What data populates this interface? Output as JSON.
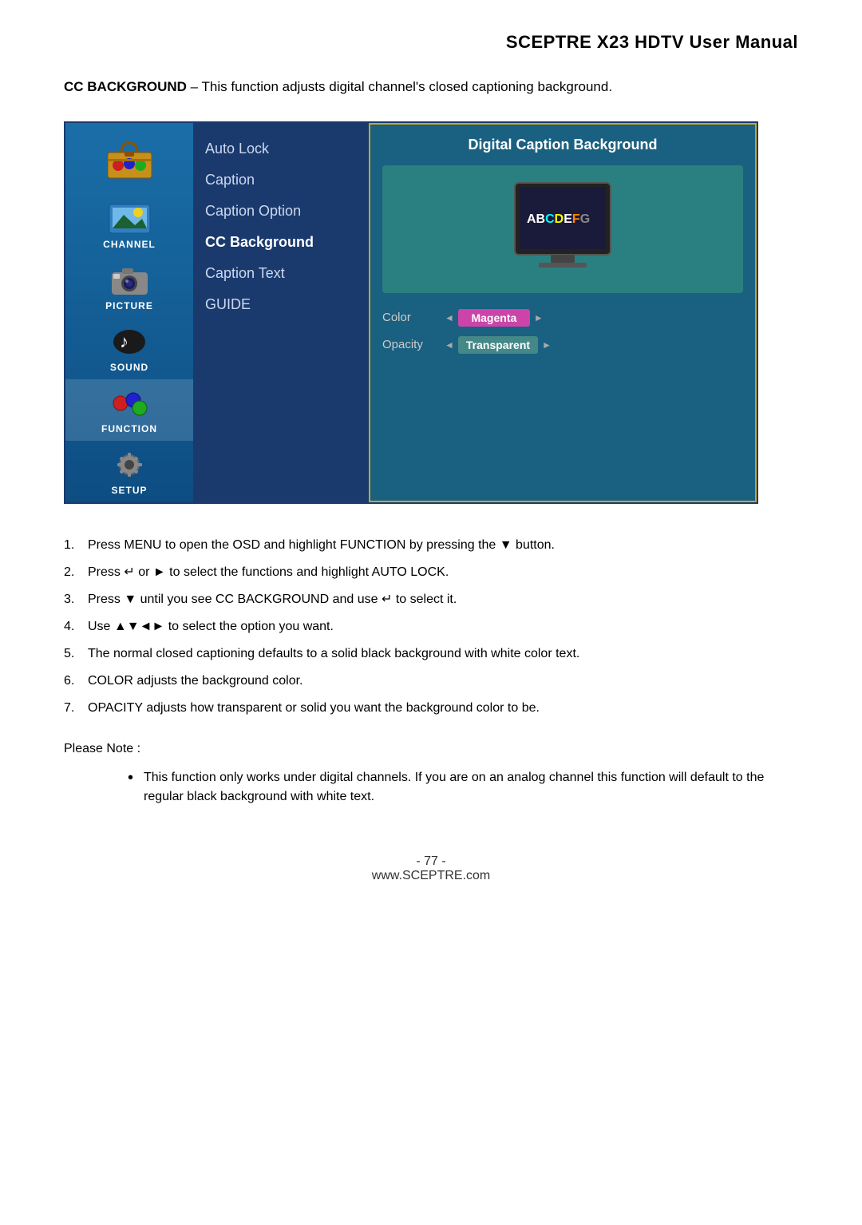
{
  "header": {
    "title": "SCEPTRE X23 HDTV User Manual"
  },
  "intro": {
    "bold": "CC BACKGROUND",
    "text": " – This function adjusts digital channel's closed captioning background."
  },
  "osd": {
    "sidebar": {
      "items": [
        {
          "label": "",
          "id": "toolbox",
          "active": false
        },
        {
          "label": "CHANNEL",
          "id": "channel",
          "active": false
        },
        {
          "label": "PICTURE",
          "id": "picture",
          "active": false
        },
        {
          "label": "SOUND",
          "id": "sound",
          "active": false
        },
        {
          "label": "FUNCTION",
          "id": "function",
          "active": true
        },
        {
          "label": "SETUP",
          "id": "setup",
          "active": false
        }
      ]
    },
    "menu": {
      "items": [
        {
          "label": "Auto Lock",
          "active": false
        },
        {
          "label": "Caption",
          "active": false
        },
        {
          "label": "Caption Option",
          "active": false
        },
        {
          "label": "CC Background",
          "active": true
        },
        {
          "label": "Caption Text",
          "active": false
        },
        {
          "label": "GUIDE",
          "active": false
        }
      ]
    },
    "panel": {
      "title": "Digital Caption Background",
      "caption_demo": "ABCDEFG",
      "options": [
        {
          "label": "Color",
          "value": "Magenta",
          "style": "magenta"
        },
        {
          "label": "Opacity",
          "value": "Transparent",
          "style": "transparent"
        }
      ]
    }
  },
  "instructions": [
    {
      "num": "1.",
      "text": "Press MENU to open the OSD and highlight FUNCTION by pressing the ▼ button."
    },
    {
      "num": "2.",
      "text": "Press ↵ or ► to select the functions and highlight AUTO LOCK."
    },
    {
      "num": "3.",
      "text": "Press ▼ until you see CC BACKGROUND and use ↵ to select it."
    },
    {
      "num": "4.",
      "text": "Use ▲▼◄► to select the option you want."
    },
    {
      "num": "5.",
      "text": "The normal closed captioning defaults to a solid black background with white color text."
    },
    {
      "num": "6.",
      "text": "COLOR adjusts the background color."
    },
    {
      "num": "7.",
      "text": "OPACITY adjusts how transparent or solid you want the background color to be."
    }
  ],
  "please_note": {
    "label": "Please Note :",
    "bullets": [
      "This function only works under digital channels.  If you are on an analog channel this function will default to the regular black background with white text."
    ]
  },
  "footer": {
    "page": "- 77 -",
    "website": "www.SCEPTRE.com"
  }
}
